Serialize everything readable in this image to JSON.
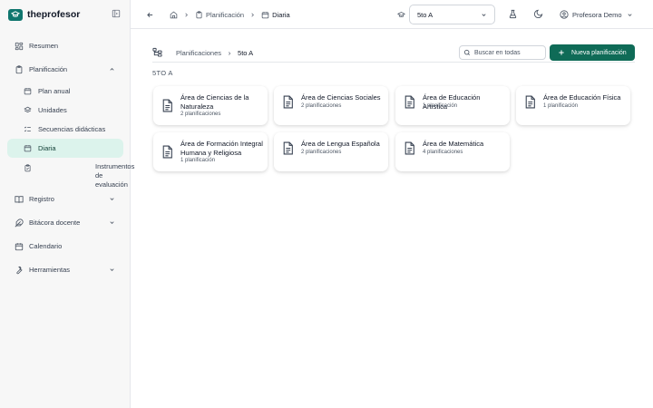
{
  "app": {
    "name": "theprofesor"
  },
  "sidebar": {
    "items": [
      {
        "label": "Resumen",
        "icon": "dashboard-icon"
      },
      {
        "label": "Planificación",
        "icon": "clipboard-icon",
        "expanded": true,
        "children": [
          {
            "label": "Plan anual",
            "icon": "calendar-icon"
          },
          {
            "label": "Unidades",
            "icon": "layers-icon"
          },
          {
            "label": "Secuencias didácticas",
            "icon": "list-checks-icon"
          },
          {
            "label": "Diaria",
            "icon": "calendar-icon",
            "active": true
          },
          {
            "label": "Instrumentos de evaluación",
            "icon": "clipboard-check-icon"
          }
        ]
      },
      {
        "label": "Registro",
        "icon": "book-open-icon"
      },
      {
        "label": "Bitácora docente",
        "icon": "feather-icon"
      },
      {
        "label": "Calendario",
        "icon": "calendar-icon"
      },
      {
        "label": "Herramientas",
        "icon": "wrench-icon"
      }
    ]
  },
  "topbar": {
    "breadcrumb": [
      {
        "label": "",
        "icon": "home-icon"
      },
      {
        "label": "Planificación",
        "icon": "clipboard-icon"
      },
      {
        "label": "Diaria",
        "icon": "calendar-icon"
      }
    ],
    "grade_select": {
      "value": "5to A"
    },
    "user": {
      "name": "Profesora Demo"
    }
  },
  "content": {
    "breadcrumb": [
      "Planificaciones",
      "5to A"
    ],
    "search": {
      "placeholder": "Buscar en todas"
    },
    "new_button": "Nueva planificación",
    "section_label": "5TO A",
    "cards": [
      {
        "title": "Área de Ciencias de la Naturaleza",
        "count": "2 planificaciones"
      },
      {
        "title": "Área de Ciencias Sociales",
        "count": "2 planificaciones"
      },
      {
        "title": "Área de Educación Artística",
        "count": "1 planificación"
      },
      {
        "title": "Área de Educación Física",
        "count": "1 planificación"
      },
      {
        "title": "Área de Formación Integral Humana y Religiosa",
        "count": "1 planificación"
      },
      {
        "title": "Área de Lengua Española",
        "count": "2 planificaciones"
      },
      {
        "title": "Área de Matemática",
        "count": "4 planificaciones"
      }
    ]
  },
  "colors": {
    "brand": "#0f766e",
    "primary_button": "#0f6b57",
    "active_nav": "#dcf3ec"
  }
}
